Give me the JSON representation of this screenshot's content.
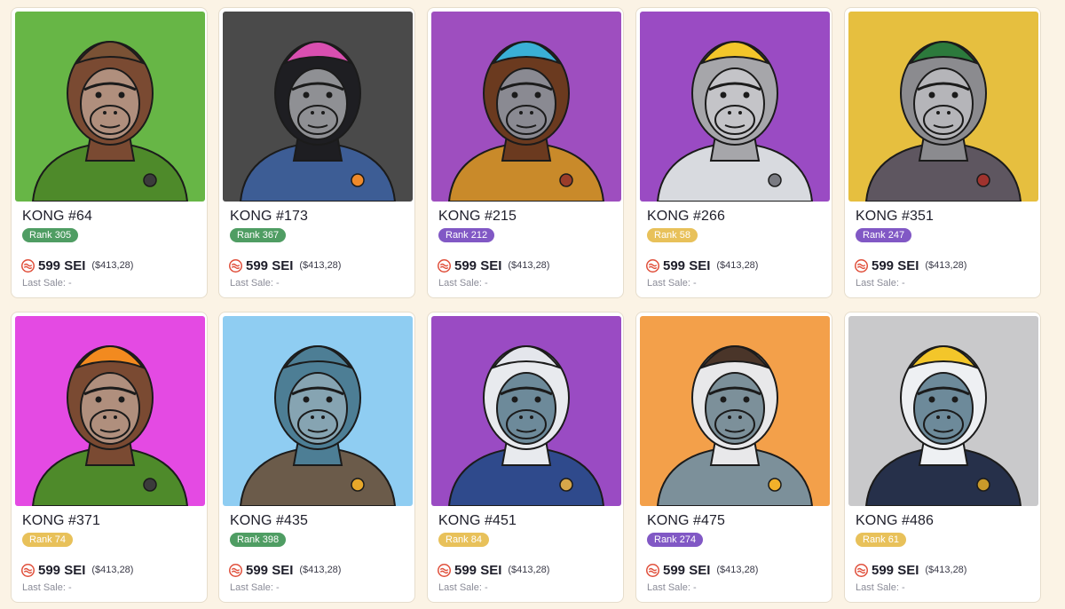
{
  "currency": "SEI",
  "cards": [
    {
      "name": "KONG #64",
      "rank": "Rank 305",
      "rank_color": "#4f9d63",
      "price": "599 SEI",
      "usd": "($413,28)",
      "last_sale_label": "Last Sale:",
      "last_sale_value": "-",
      "bg": "#67b646",
      "fur": "#7a4a32",
      "face": "#b08f7d",
      "outfit": "#4e8a2a",
      "hat": "#7a5235",
      "accent": "#3b3b3b"
    },
    {
      "name": "KONG #173",
      "rank": "Rank 367",
      "rank_color": "#4f9d63",
      "price": "599 SEI",
      "usd": "($413,28)",
      "last_sale_label": "Last Sale:",
      "last_sale_value": "-",
      "bg": "#4a4a4a",
      "fur": "#1e1e22",
      "face": "#8f9094",
      "outfit": "#3d5d95",
      "hat": "#d94fb0",
      "accent": "#f08a2a"
    },
    {
      "name": "KONG #215",
      "rank": "Rank 212",
      "rank_color": "#8158c5",
      "price": "599 SEI",
      "usd": "($413,28)",
      "last_sale_label": "Last Sale:",
      "last_sale_value": "-",
      "bg": "#9e4ebf",
      "fur": "#6b3a1f",
      "face": "#8a8a92",
      "outfit": "#c98a2a",
      "hat": "#3ab0d6",
      "accent": "#9b3d2a"
    },
    {
      "name": "KONG #266",
      "rank": "Rank 58",
      "rank_color": "#e8c15a",
      "price": "599 SEI",
      "usd": "($413,28)",
      "last_sale_label": "Last Sale:",
      "last_sale_value": "-",
      "bg": "#9a4bc3",
      "fur": "#a6a6aa",
      "face": "#c4c4c8",
      "outfit": "#d8dadf",
      "hat": "#f3c62a",
      "accent": "#7a7b82"
    },
    {
      "name": "KONG #351",
      "rank": "Rank 247",
      "rank_color": "#8158c5",
      "price": "599 SEI",
      "usd": "($413,28)",
      "last_sale_label": "Last Sale:",
      "last_sale_value": "-",
      "bg": "#e6bf3f",
      "fur": "#8b8b8f",
      "face": "#b5b5b9",
      "outfit": "#5e5660",
      "hat": "#2c7a3c",
      "accent": "#a0332e"
    },
    {
      "name": "KONG #371",
      "rank": "Rank 74",
      "rank_color": "#e8c15a",
      "price": "599 SEI",
      "usd": "($413,28)",
      "last_sale_label": "Last Sale:",
      "last_sale_value": "-",
      "bg": "#e44ae3",
      "fur": "#7a4a32",
      "face": "#b08f7d",
      "outfit": "#4e8a2a",
      "hat": "#f28a1f",
      "accent": "#3b3b3b"
    },
    {
      "name": "KONG #435",
      "rank": "Rank 398",
      "rank_color": "#4f9d63",
      "price": "599 SEI",
      "usd": "($413,28)",
      "last_sale_label": "Last Sale:",
      "last_sale_value": "-",
      "bg": "#8fcdf2",
      "fur": "#4d7e95",
      "face": "#86a4b2",
      "outfit": "#6b5b4a",
      "hat": "#4d7e95",
      "accent": "#e8a82a"
    },
    {
      "name": "KONG #451",
      "rank": "Rank 84",
      "rank_color": "#e8c15a",
      "price": "599 SEI",
      "usd": "($413,28)",
      "last_sale_label": "Last Sale:",
      "last_sale_value": "-",
      "bg": "#9a4bc3",
      "fur": "#e8eaee",
      "face": "#6d8a9a",
      "outfit": "#2f4a8c",
      "hat": "#e4e6ec",
      "accent": "#d6a64a"
    },
    {
      "name": "KONG #475",
      "rank": "Rank 274",
      "rank_color": "#8158c5",
      "price": "599 SEI",
      "usd": "($413,28)",
      "last_sale_label": "Last Sale:",
      "last_sale_value": "-",
      "bg": "#f3a04a",
      "fur": "#e8e8ea",
      "face": "#7c909a",
      "outfit": "#7c909a",
      "hat": "#4a3529",
      "accent": "#f2b12a"
    },
    {
      "name": "KONG #486",
      "rank": "Rank 61",
      "rank_color": "#e8c15a",
      "price": "599 SEI",
      "usd": "($413,28)",
      "last_sale_label": "Last Sale:",
      "last_sale_value": "-",
      "bg": "#c9c9cb",
      "fur": "#eef0f3",
      "face": "#6d8a9a",
      "outfit": "#26304a",
      "hat": "#f3c62a",
      "accent": "#c99a2a"
    }
  ]
}
